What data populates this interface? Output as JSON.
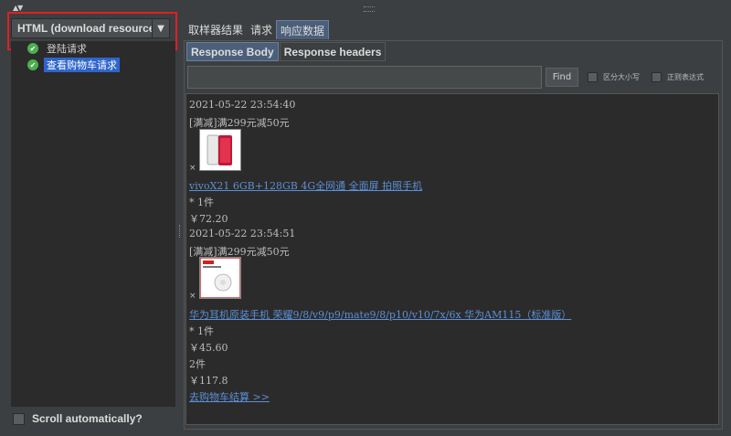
{
  "window": {
    "collapse_arrows": "▲▼"
  },
  "left_pane": {
    "renderer_select": {
      "value": "HTML (download resources)",
      "arrow": "▼"
    },
    "tree": [
      {
        "label": "登陆请求",
        "selected": false
      },
      {
        "label": "查看购物车请求",
        "selected": true
      }
    ],
    "scroll_automatically": {
      "label": "Scroll automatically?",
      "checked": false
    }
  },
  "outer_tabs": [
    "取样器结果",
    "请求",
    "响应数据"
  ],
  "inner_tabs": [
    "Response Body",
    "Response headers"
  ],
  "search": {
    "value": "",
    "find_label": "Find",
    "case_sensitive_label": "区分大小写",
    "regex_label": "正则表达式"
  },
  "response": {
    "item1": {
      "time": "2021-05-22 23:54:40",
      "promo": "[满减]满299元减50元",
      "x": "×",
      "product": "vivoX21 6GB+128GB 4G全网通 全面屏 拍照手机",
      "qty": "* 1件",
      "price": "￥72.20"
    },
    "item2": {
      "time": "2021-05-22 23:54:51",
      "promo": "[满减]满299元减50元",
      "x": "×",
      "product": "华为耳机原装手机 荣耀9/8/v9/p9/mate9/8/p10/v10/7x/6x 华为AM115（标准版）",
      "qty": "* 1件",
      "price": "￥45.60"
    },
    "total_qty": "2件",
    "total_price": "￥117.8",
    "checkout_link": "去购物车结算 >>"
  },
  "colors": {
    "background": "#3c3f41",
    "panel": "#2b2b2b",
    "selection": "#2f65ca",
    "link": "#5c8fd6",
    "highlight": "#e02020"
  }
}
